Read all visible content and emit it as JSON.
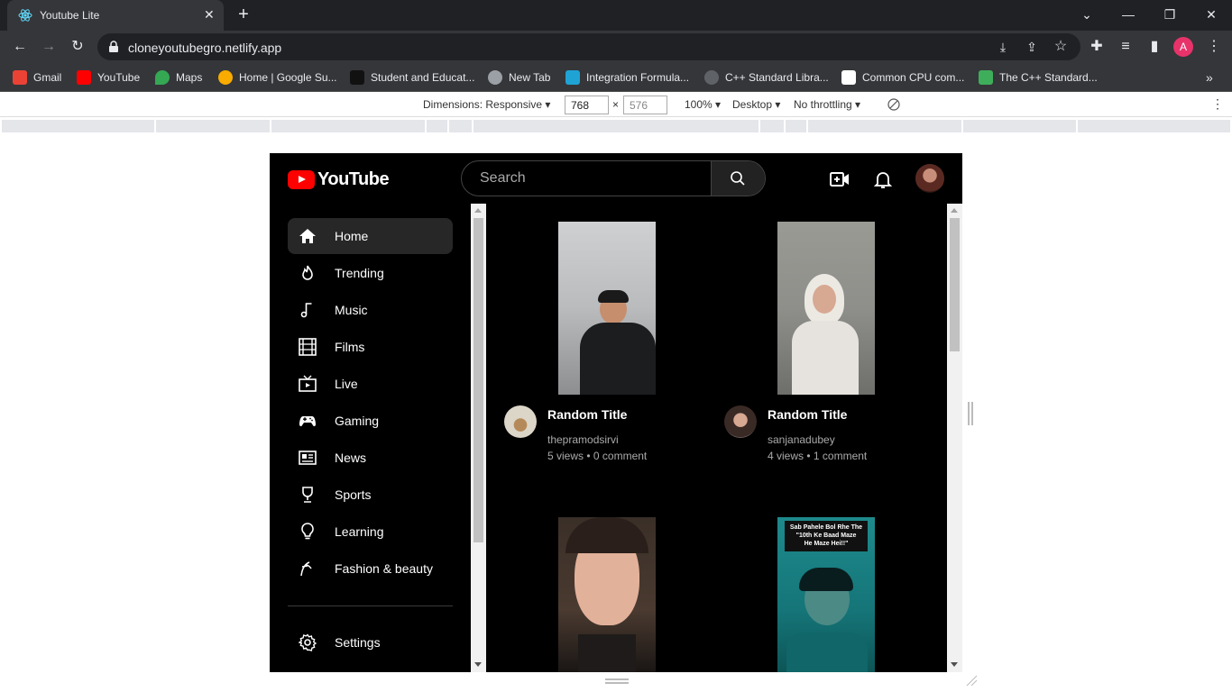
{
  "browser": {
    "tab_title": "Youtube Lite",
    "url": "cloneyoutubegro.netlify.app",
    "bookmarks": [
      {
        "label": "Gmail",
        "color": "#ea4335"
      },
      {
        "label": "YouTube",
        "color": "#ff0000"
      },
      {
        "label": "Maps",
        "color": "#34a853"
      },
      {
        "label": "Home | Google Su...",
        "color": "#f9ab00"
      },
      {
        "label": "Student and Educat...",
        "color": "#111111"
      },
      {
        "label": "New Tab",
        "color": "#9aa0a6"
      },
      {
        "label": "Integration Formula...",
        "color": "#1fa3d5"
      },
      {
        "label": "C++ Standard Libra...",
        "color": "#5f6368"
      },
      {
        "label": "Common CPU com...",
        "color": "#ffffff"
      },
      {
        "label": "The C++ Standard...",
        "color": "#3fae5a"
      }
    ],
    "profile_initial": "A"
  },
  "devtools": {
    "dimensions_label": "Dimensions: Responsive",
    "width": "768",
    "height": "576",
    "times": "×",
    "zoom": "100%",
    "device": "Desktop",
    "throttling": "No throttling"
  },
  "app": {
    "logo_text": "YouTube",
    "search_placeholder": "Search",
    "sidebar": [
      {
        "label": "Home",
        "icon": "home-icon",
        "active": true
      },
      {
        "label": "Trending",
        "icon": "fire-icon"
      },
      {
        "label": "Music",
        "icon": "music-note-icon"
      },
      {
        "label": "Films",
        "icon": "film-icon"
      },
      {
        "label": "Live",
        "icon": "live-tv-icon"
      },
      {
        "label": "Gaming",
        "icon": "gamepad-icon"
      },
      {
        "label": "News",
        "icon": "newspaper-icon"
      },
      {
        "label": "Sports",
        "icon": "trophy-icon"
      },
      {
        "label": "Learning",
        "icon": "lightbulb-icon"
      },
      {
        "label": "Fashion & beauty",
        "icon": "hanger-icon"
      }
    ],
    "settings_label": "Settings",
    "videos": [
      {
        "title": "Random Title",
        "channel": "thepramodsirvi",
        "views": "5 views",
        "comments": "0 comment"
      },
      {
        "title": "Random Title",
        "channel": "sanjanadubey",
        "views": "4 views",
        "comments": "1 comment"
      },
      {
        "caption_line1": "Sab Pahele Bol Rhe The",
        "caption_line2": "\"10th Ke Baad Maze",
        "caption_line3": "He Maze Hei!!\""
      }
    ],
    "meta_separator": "•"
  }
}
